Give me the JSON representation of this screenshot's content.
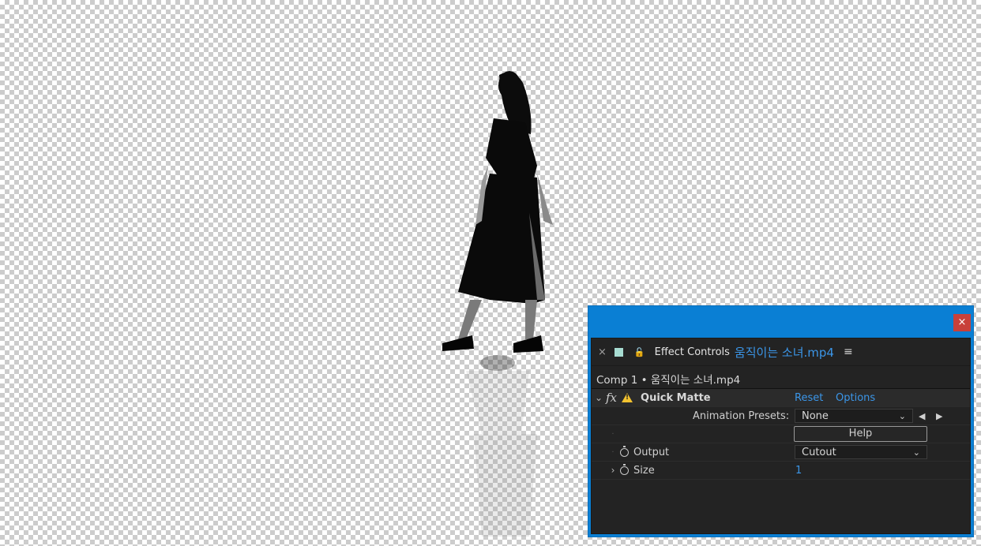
{
  "window": {
    "close_label": "×"
  },
  "panel": {
    "tab_close": "×",
    "title": "Effect Controls",
    "file": "움직이는 소녀.mp4",
    "comp_line": "Comp 1 • 움직이는 소녀.mp4"
  },
  "effect": {
    "fx_label": "fx",
    "name": "Quick Matte",
    "reset": "Reset",
    "options": "Options",
    "presets_label": "Animation Presets:",
    "presets_value": "None",
    "help": "Help",
    "output_label": "Output",
    "output_value": "Cutout",
    "size_label": "Size",
    "size_value": "1"
  },
  "icons": {
    "menu": "≡",
    "lock": "🔓",
    "chevron_down": "⌄",
    "chevron_right": "›",
    "prev": "◀",
    "next": "▶"
  },
  "colors": {
    "window_blue": "#0a7fd4",
    "link_blue": "#3b96e8",
    "warning_yellow": "#f2c230",
    "swatch": "#a7dcd2"
  }
}
